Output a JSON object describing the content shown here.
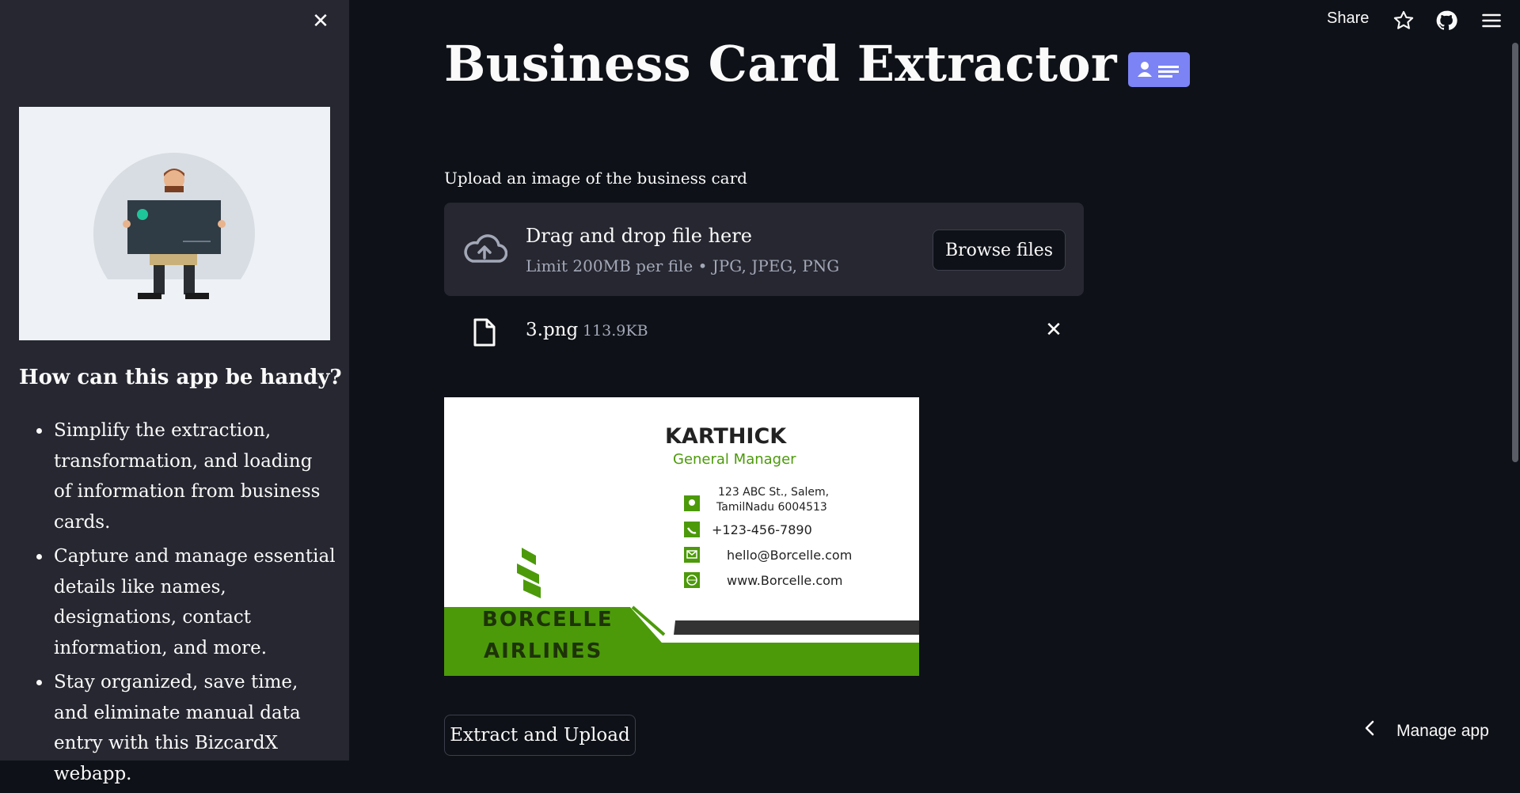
{
  "sidebar": {
    "close_icon": "close-icon",
    "illustration": "person-holding-business-card-illustration",
    "heading": "How can this app be handy?",
    "bullets": [
      "Simplify the extraction, transformation, and loading of information from business cards.",
      "Capture and manage essential details like names, designations, contact information, and more.",
      "Stay organized, save time, and eliminate manual data entry with this BizcardX webapp."
    ]
  },
  "header": {
    "share_label": "Share",
    "icons": [
      "star-icon",
      "github-icon",
      "hamburger-menu-icon"
    ]
  },
  "main": {
    "title": "Business Card Extractor",
    "title_badge_icon": "contact-card-icon",
    "uploader": {
      "label": "Upload an image of the business card",
      "dropzone_title": "Drag and drop file here",
      "dropzone_subtitle": "Limit 200MB per file • JPG, JPEG, PNG",
      "browse_label": "Browse files"
    },
    "file": {
      "name": "3.png",
      "size": "113.9KB"
    },
    "card": {
      "name": "KARTHICK",
      "designation": "General Manager",
      "address_line1": "123 ABC St., Salem,",
      "address_line2": "TamilNadu 6004513",
      "phone": "+123-456-7890",
      "email": "hello@Borcelle.com",
      "website": "www.Borcelle.com",
      "company_line1": "BORCELLE",
      "company_line2": "AIRLINES"
    },
    "extract_label": "Extract and Upload"
  },
  "footer": {
    "manage_app_label": "Manage app"
  },
  "colors": {
    "background": "#0e1117",
    "sidebar": "#262730",
    "accent_badge": "#7b83f5",
    "card_green": "#4c9a0a"
  }
}
